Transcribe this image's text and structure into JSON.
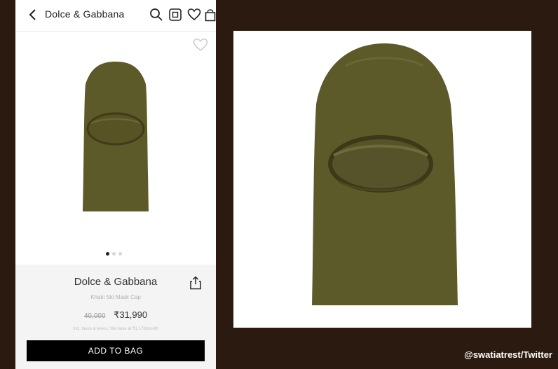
{
  "header": {
    "title": "Dolce & Gabbana"
  },
  "icons": {
    "back": "chevron-left-icon",
    "search": "search-icon",
    "scan": "scan-icon",
    "wishlist": "heart-icon",
    "bag": "shopping-bag-icon",
    "share": "share-icon"
  },
  "product": {
    "brand": "Dolce & Gabbana",
    "subtitle": "Khaki Ski Mask Cap",
    "old_price": "40,000",
    "price": "₹31,990",
    "tax_note": "Incl. taxes & levies. We have at ₹1,178/month",
    "add_to_bag": "ADD TO BAG",
    "color": "#5d5a2a",
    "carousel": {
      "total": 3,
      "active": 1
    }
  },
  "credit": "@swatiatrest/Twitter"
}
